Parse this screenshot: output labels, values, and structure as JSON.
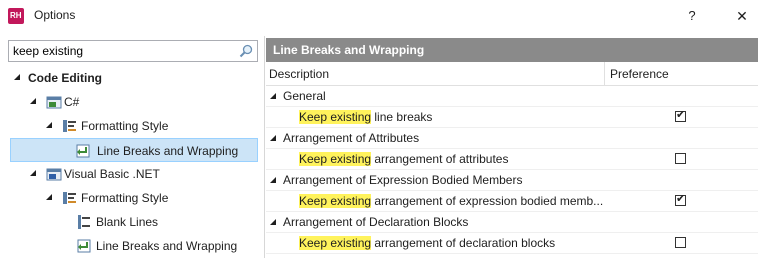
{
  "window": {
    "title": "Options",
    "help_label": "?",
    "close_label": "✕"
  },
  "search": {
    "value": "keep existing"
  },
  "tree": {
    "items": [
      {
        "label": "Code Editing"
      },
      {
        "label": "C#"
      },
      {
        "label": "Formatting Style"
      },
      {
        "label": "Line Breaks and Wrapping"
      },
      {
        "label": "Visual Basic .NET"
      },
      {
        "label": "Formatting Style"
      },
      {
        "label": "Blank Lines"
      },
      {
        "label": "Line Breaks and Wrapping"
      }
    ]
  },
  "panel": {
    "title": "Line Breaks and Wrapping",
    "columns": {
      "description": "Description",
      "preference": "Preference"
    },
    "groups": [
      {
        "label": "General",
        "item": {
          "highlight": "Keep existing",
          "rest": " line breaks",
          "checked": true
        }
      },
      {
        "label": "Arrangement of Attributes",
        "item": {
          "highlight": "Keep existing",
          "rest": " arrangement of attributes",
          "checked": false
        }
      },
      {
        "label": "Arrangement of Expression Bodied Members",
        "item": {
          "highlight": "Keep existing",
          "rest": " arrangement of expression bodied memb...",
          "checked": true
        }
      },
      {
        "label": "Arrangement of Declaration Blocks",
        "item": {
          "highlight": "Keep existing",
          "rest": " arrangement of declaration blocks",
          "checked": false
        }
      }
    ]
  },
  "colors": {
    "selection": "#cce4f7",
    "highlight": "#fff35c",
    "section_header": "#8a8a8a"
  }
}
